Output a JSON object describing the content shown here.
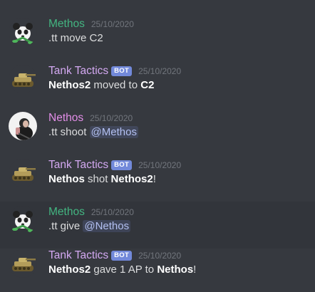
{
  "colors": {
    "background": "#36393f",
    "highlight_row": "#32353b",
    "user_methos": "#43b581",
    "user_tank": "#d4a9f2",
    "user_nethos": "#e38ee8",
    "bot_tag_bg": "#7289da",
    "mention_text": "#b3c0f2",
    "timestamp": "#72767d",
    "text": "#dcddde"
  },
  "messages": [
    {
      "author": "Methos",
      "timestamp": "25/10/2020",
      "avatar_icon": "panda-avatar-icon",
      "text": ".tt move C2"
    },
    {
      "author": "Tank Tactics",
      "bot_tag": "BOT",
      "timestamp": "25/10/2020",
      "avatar_icon": "tank-avatar-icon",
      "bold1": "Nethos2",
      "mid": " moved to ",
      "bold2": "C2"
    },
    {
      "author": "Nethos",
      "timestamp": "25/10/2020",
      "avatar_icon": "nethos-avatar-icon",
      "text": ".tt shoot ",
      "mention": "@Methos"
    },
    {
      "author": "Tank Tactics",
      "bot_tag": "BOT",
      "timestamp": "25/10/2020",
      "avatar_icon": "tank-avatar-icon",
      "bold1": "Nethos",
      "mid": " shot ",
      "bold2": "Nethos2",
      "end": "!"
    },
    {
      "author": "Methos",
      "timestamp": "25/10/2020",
      "avatar_icon": "panda-avatar-icon",
      "text": ".tt give ",
      "mention": "@Nethos"
    },
    {
      "author": "Tank Tactics",
      "bot_tag": "BOT",
      "timestamp": "25/10/2020",
      "avatar_icon": "tank-avatar-icon",
      "bold1": "Nethos2",
      "mid": " gave 1 AP to ",
      "bold2": "Nethos",
      "end": "!"
    }
  ]
}
